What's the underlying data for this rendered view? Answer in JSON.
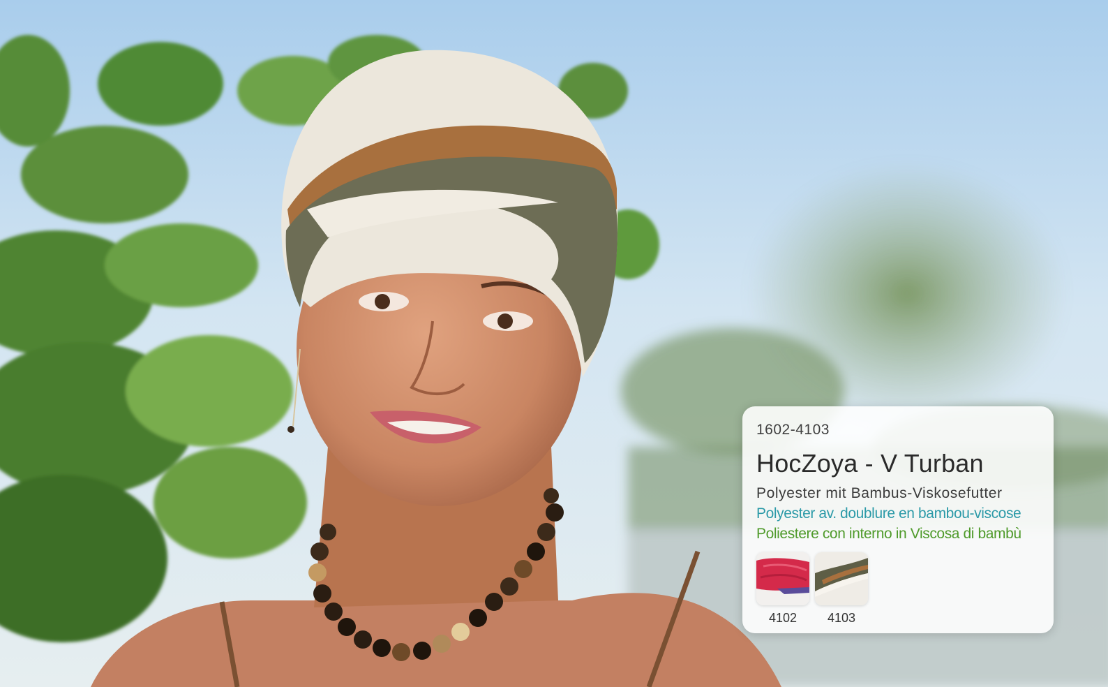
{
  "product": {
    "article_number": "1602-4103",
    "title": "HocZoya - V Turban",
    "descriptions": {
      "de": "Polyester mit Bambus-Viskosefutter",
      "fr": "Polyester av. doublure en bambou-viscose",
      "it": "Poliestere con interno in Viscosa di bambù"
    },
    "color_variants": [
      {
        "code": "4102",
        "icon": "red-turban-swatch"
      },
      {
        "code": "4103",
        "icon": "cream-brown-olive-turban-swatch"
      }
    ]
  },
  "colors": {
    "french_text": "#2c9aa8",
    "italian_text": "#4e9a2a",
    "card_background": "#ffffff"
  }
}
